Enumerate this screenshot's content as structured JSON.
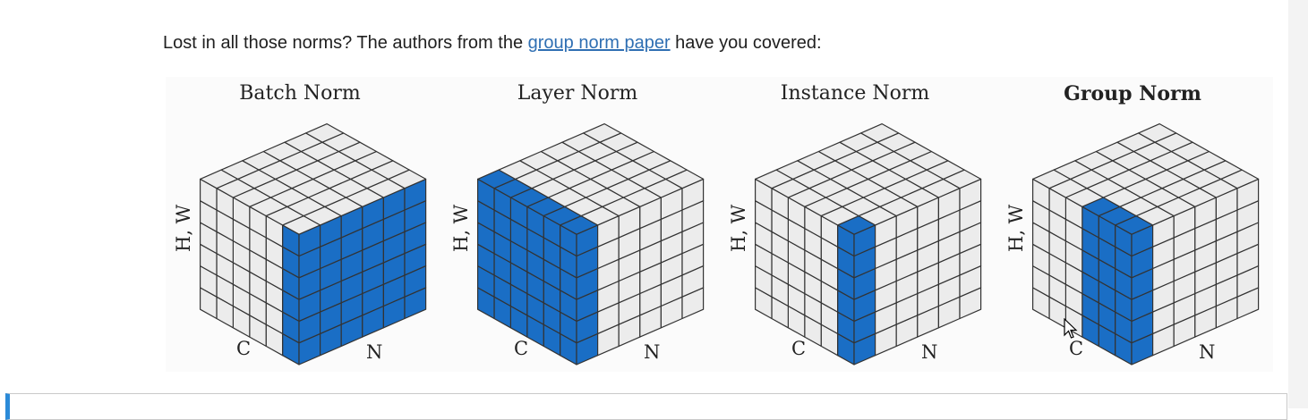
{
  "intro": {
    "before": "Lost in all those norms? The authors from the ",
    "link": "group norm paper",
    "after": " have you covered:"
  },
  "figure": {
    "panels": [
      {
        "title": "Batch Norm",
        "mode": "batch",
        "bold": false
      },
      {
        "title": "Layer Norm",
        "mode": "layer",
        "bold": false
      },
      {
        "title": "Instance Norm",
        "mode": "instance",
        "bold": false
      },
      {
        "title": "Group Norm",
        "mode": "group",
        "bold": true
      }
    ],
    "axis_labels": {
      "hw": "H, W",
      "c": "C",
      "n": "N"
    },
    "colors": {
      "highlight": "#1a6ec5",
      "cell": "#ececec",
      "grid": "#333333"
    }
  },
  "icons": {
    "cursor": "mouse-pointer-icon"
  }
}
